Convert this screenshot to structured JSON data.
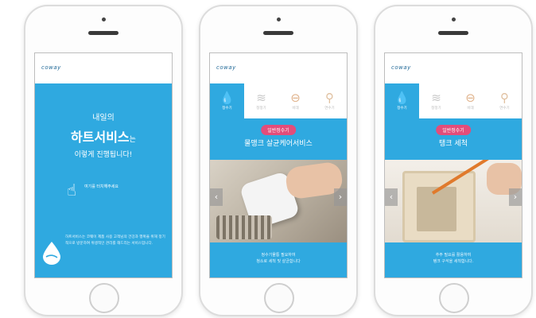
{
  "colors": {
    "screen_bg": "#2fa9e0",
    "pill_bg": "#e34d7a"
  },
  "logo": "coway",
  "screen1": {
    "line1": "내일의",
    "highlight": "하트서비스",
    "suffix": "는",
    "line3": "이렇게 진행됩니다!",
    "tap_text": "여기를 터치해주세요",
    "body": "하트서비스는 코웨이 제품 사용 고객님의 건강과 행복을 위해 정기적으로 방문하여 위생적인 관리를 해드리는 서비스입니다."
  },
  "tabs": [
    {
      "label": "정수기",
      "icon": "water-drop-icon"
    },
    {
      "label": "청정기",
      "icon": "air-wave-icon"
    },
    {
      "label": "비데",
      "icon": "bidet-icon"
    },
    {
      "label": "연수기",
      "icon": "softener-icon"
    }
  ],
  "screen2": {
    "pill": "일반정수기",
    "title": "물맹크 살균케어서비스",
    "caption1": "정수기물통 필요하여",
    "caption2": "청소로 세척 및 살균합니다"
  },
  "screen3": {
    "pill": "일반정수기",
    "title": "탱크 세척",
    "caption1": "추주 필요를 활용하여",
    "caption2": "탱크 구석을 세척합니다."
  },
  "nav": {
    "prev": "‹",
    "next": "›"
  }
}
